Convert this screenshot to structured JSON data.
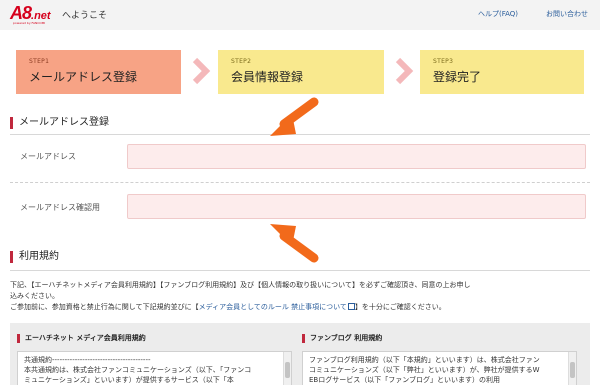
{
  "header": {
    "logo_main": "A8",
    "logo_suffix": ".net",
    "logo_sub": "powered by FANCOMI",
    "welcome": "へようこそ",
    "help": "ヘルプ(FAQ)",
    "contact": "お問い合わせ"
  },
  "steps": [
    {
      "num": "STEP1",
      "title": "メールアドレス登録"
    },
    {
      "num": "STEP2",
      "title": "会員情報登録"
    },
    {
      "num": "STEP3",
      "title": "登録完了"
    }
  ],
  "email_section": {
    "heading": "メールアドレス登録",
    "email_label": "メールアドレス",
    "confirm_label": "メールアドレス確認用"
  },
  "terms_section": {
    "heading": "利用規約",
    "line1": "下記、【エーハチネットメディア会員利用規約】【ファンブログ利用規約】及び【個人情報の取り扱いについて】を必ずご確認頂き、同意の上お申し",
    "line2": "込みください。",
    "line3_pre": "ご参加前に、参加資格と禁止行為に関して下記規約並びに【",
    "line3_link": "メディア会員としてのルール 禁止事項について",
    "line3_post": "】を十分にご確認ください。"
  },
  "panels": [
    {
      "title": "エーハチネット メディア会員利用規約",
      "body1": "共通規約---------------------------------------",
      "body2": "本共通規約は、株式会社ファンコミュニケーションズ（以下、「ファンコ",
      "body3": "ミュニケーションズ」といいます）が提供するサービス（以下「本"
    },
    {
      "title": "ファンブログ 利用規約",
      "body1": "ファンブログ利用規約（以下「本規約」といいます）は、株式会社ファン",
      "body2": "コミュニケーションズ（以下「弊社」といいます）が、弊社が提供するW",
      "body3": "EBログサービス（以下「ファンブログ」といいます）の利用"
    }
  ],
  "colors": {
    "brand_red": "#d6001c",
    "step_active": "#f7a385",
    "step_inactive": "#f9e98e",
    "chevron": "#f4b8ba",
    "arrow": "#f26a1b",
    "input_bg": "#fdecec",
    "link": "#2a5d9b"
  }
}
